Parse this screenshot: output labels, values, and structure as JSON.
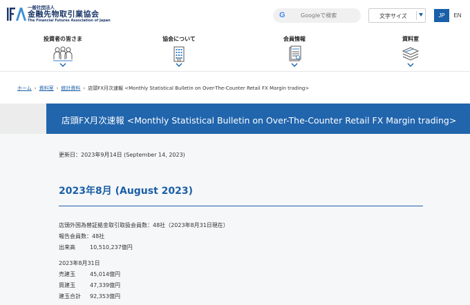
{
  "header": {
    "org_small": "一般社団法人",
    "org_name": "金融先物取引業協会",
    "org_en": "The Financial Futures Association of Japan",
    "search_placeholder": "Googleで検索",
    "font_size_label": "文字サイズ",
    "lang_jp": "JP",
    "lang_en": "EN",
    "brand_color": "#1a5fa8"
  },
  "nav": [
    {
      "label": "投資者の皆さま",
      "icon": "people-icon"
    },
    {
      "label": "協会について",
      "icon": "building-icon"
    },
    {
      "label": "会員情報",
      "icon": "document-icon"
    },
    {
      "label": "資料室",
      "icon": "stack-icon"
    }
  ],
  "breadcrumb": {
    "home": "ホーム",
    "library": "資料室",
    "stats": "統計資料",
    "current": "店頭FX月次速報 <Monthly Statistical Bulletin on Over-The-Counter Retail FX Margin trading>"
  },
  "banner": {
    "title": "店頭FX月次速報 <Monthly Statistical Bulletin on Over-The-Counter Retail FX Margin trading>"
  },
  "content": {
    "updated": "更新日：2023年9月14日 (September 14, 2023)",
    "heading": "2023年8月 (August 2023)",
    "members_line": "店頭外国為替証拠金取引取扱会員数：48社（2023年8月31日現在）",
    "reporting_line": "報告会員数：48社",
    "volume_label": "出来高",
    "volume_value": "10,510,237億円",
    "date_line": "2023年8月31日",
    "sell_label": "売建玉",
    "sell_value": "45,014億円",
    "buy_label": "買建玉",
    "buy_value": "47,339億円",
    "total_label": "建玉合計",
    "total_value": "92,353億円"
  }
}
